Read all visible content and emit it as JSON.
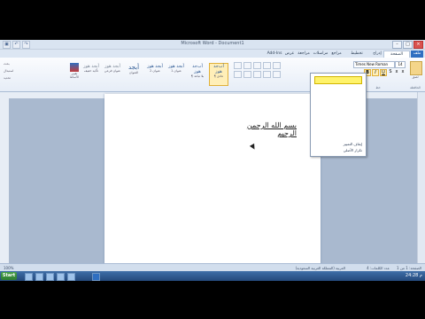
{
  "window": {
    "title": "Microsoft Word - Document1"
  },
  "tabs": [
    "ملف",
    "الصفحة الرئيسية",
    "إدراج",
    "تخطيط الصفحة",
    "مراجع",
    "مراسلات",
    "مراجعة",
    "عرض",
    "Add-Ins"
  ],
  "ribbon": {
    "styles": [
      {
        "preview": "أب‌جد هوز",
        "name": "¶ عادي",
        "selected": true
      },
      {
        "preview": "أب‌جد هوز",
        "name": "¶ بلا تباعد"
      },
      {
        "preview": "أبجد هوز",
        "name": "عنوان 1"
      },
      {
        "preview": "أبجد هوز",
        "name": "عنوان 2"
      },
      {
        "preview": "أبجد",
        "name": "العنوان"
      },
      {
        "preview": "أبجد هوز",
        "name": "عنوان فرعي"
      },
      {
        "preview": "أبجد هوز",
        "name": "تأكيد خفيف"
      }
    ],
    "change_styles_label": "تغيير الأنماط",
    "editing": {
      "find": "بحث",
      "replace": "استبدال",
      "select": "تحديد"
    },
    "paste_label": "لصق",
    "font_label": "خط",
    "clipboard_label": "الحافظة",
    "font_name": "Times New Roman",
    "font_size": "14"
  },
  "dropdown": {
    "items": [
      "إيقاف التمييز",
      "تكرار الأصلي"
    ]
  },
  "document": {
    "text": "بسم الله الرحمن الرحيم"
  },
  "status": {
    "page": "الصفحة: 1 من 1",
    "words": "عدد الكلمات: 4",
    "language": "العربية (المملكة العربية السعودية)",
    "zoom": "100%"
  },
  "taskbar": {
    "start": "Start",
    "clock": "24:28 م"
  }
}
